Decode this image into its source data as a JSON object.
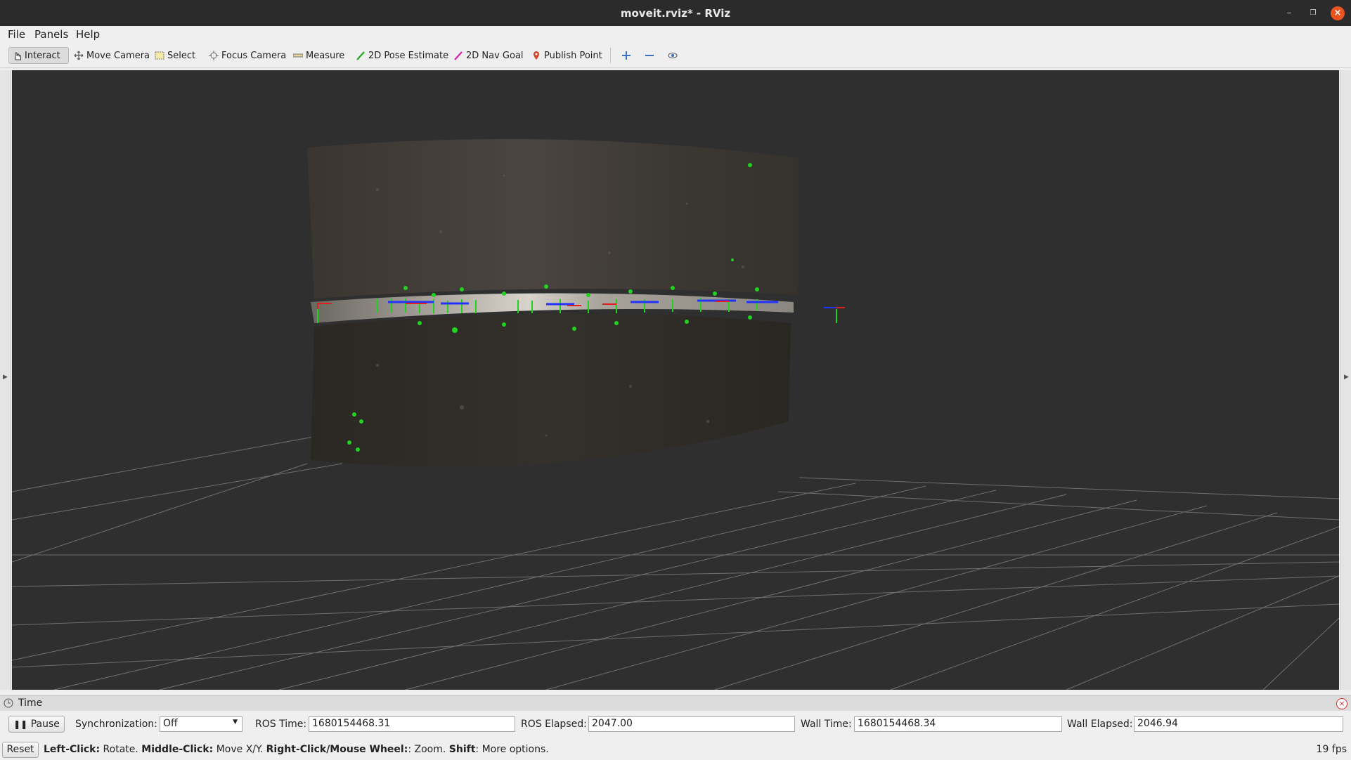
{
  "window": {
    "title": "moveit.rviz* - RViz"
  },
  "menu": {
    "file": "File",
    "panels": "Panels",
    "help": "Help"
  },
  "toolbar": {
    "interact": "Interact",
    "move_camera": "Move Camera",
    "select": "Select",
    "focus_camera": "Focus Camera",
    "measure": "Measure",
    "pose_estimate": "2D Pose Estimate",
    "nav_goal": "2D Nav Goal",
    "publish_point": "Publish Point"
  },
  "colors": {
    "titlebar": "#2b2b2b",
    "viewport": "#2f2f2f",
    "close": "#e95420",
    "accent_green": "#1fd31f"
  },
  "time_panel": {
    "title": "Time",
    "pause_label": "Pause",
    "sync_label": "Synchronization:",
    "sync_value": "Off",
    "ros_time_label": "ROS Time:",
    "ros_time": "1680154468.31",
    "ros_elapsed_label": "ROS Elapsed:",
    "ros_elapsed": "2047.00",
    "wall_time_label": "Wall Time:",
    "wall_time": "1680154468.34",
    "wall_elapsed_label": "Wall Elapsed:",
    "wall_elapsed": "2046.94"
  },
  "status": {
    "reset_label": "Reset",
    "left_click": "Left-Click:",
    "left_click_action": "Rotate.",
    "middle_click": "Middle-Click:",
    "middle_click_action": "Move X/Y.",
    "right_click": "Right-Click/Mouse Wheel:",
    "right_click_action": ": Zoom.",
    "shift": "Shift",
    "shift_action": ": More options.",
    "fps": "19 fps"
  }
}
